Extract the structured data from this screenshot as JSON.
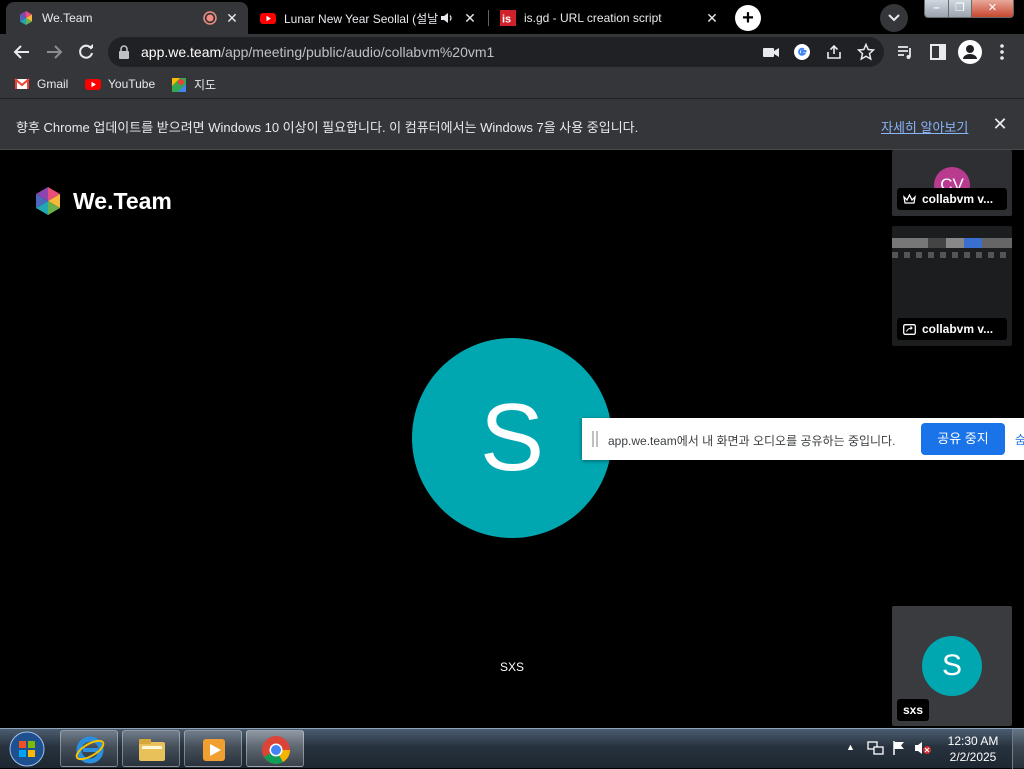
{
  "browser": {
    "tabs": [
      {
        "title": "We.Team",
        "icon": "weteam-favicon",
        "recording": true
      },
      {
        "title": "Lunar New Year Seollal (설날",
        "icon": "youtube-favicon",
        "audio": true
      },
      {
        "title": "is.gd - URL creation script",
        "icon": "isgd-favicon"
      }
    ],
    "url_host": "app.we.team",
    "url_path": "/app/meeting/public/audio/collabvm%20vm1",
    "bookmarks": [
      {
        "label": "Gmail",
        "icon": "gmail-icon"
      },
      {
        "label": "YouTube",
        "icon": "youtube-icon"
      },
      {
        "label": "지도",
        "icon": "maps-icon"
      }
    ],
    "infobar": {
      "message": "향후 Chrome 업데이트를 받으려면 Windows 10 이상이 필요합니다. 이 컴퓨터에서는 Windows 7을 사용 중입니다.",
      "link": "자세히 알아보기"
    }
  },
  "meeting": {
    "logo_text": "We.Team",
    "main_participant": {
      "initial": "S",
      "name": "SXS",
      "color": "#00a7b0"
    },
    "tiles": [
      {
        "initials": "CV",
        "label": "collabvm v...",
        "color": "#b83b8f",
        "icon": "crown-icon"
      },
      {
        "label": "collabvm v...",
        "icon": "screen-share-icon"
      },
      {
        "initial": "S",
        "label": "sxs",
        "color": "#00a7b0"
      }
    ],
    "sharebar": {
      "message": "app.we.team에서 내 화면과 오디오를 공유하는 중입니다.",
      "stop_label": "공유 중지",
      "hide_label": "숨기기"
    }
  },
  "taskbar": {
    "time": "12:30 AM",
    "date": "2/2/2025",
    "apps": [
      "internet-explorer-icon",
      "file-explorer-icon",
      "media-player-icon",
      "chrome-icon"
    ]
  },
  "colors": {
    "accent": "#1a73e8",
    "teal": "#00a7b0",
    "magenta": "#b83b8f"
  }
}
